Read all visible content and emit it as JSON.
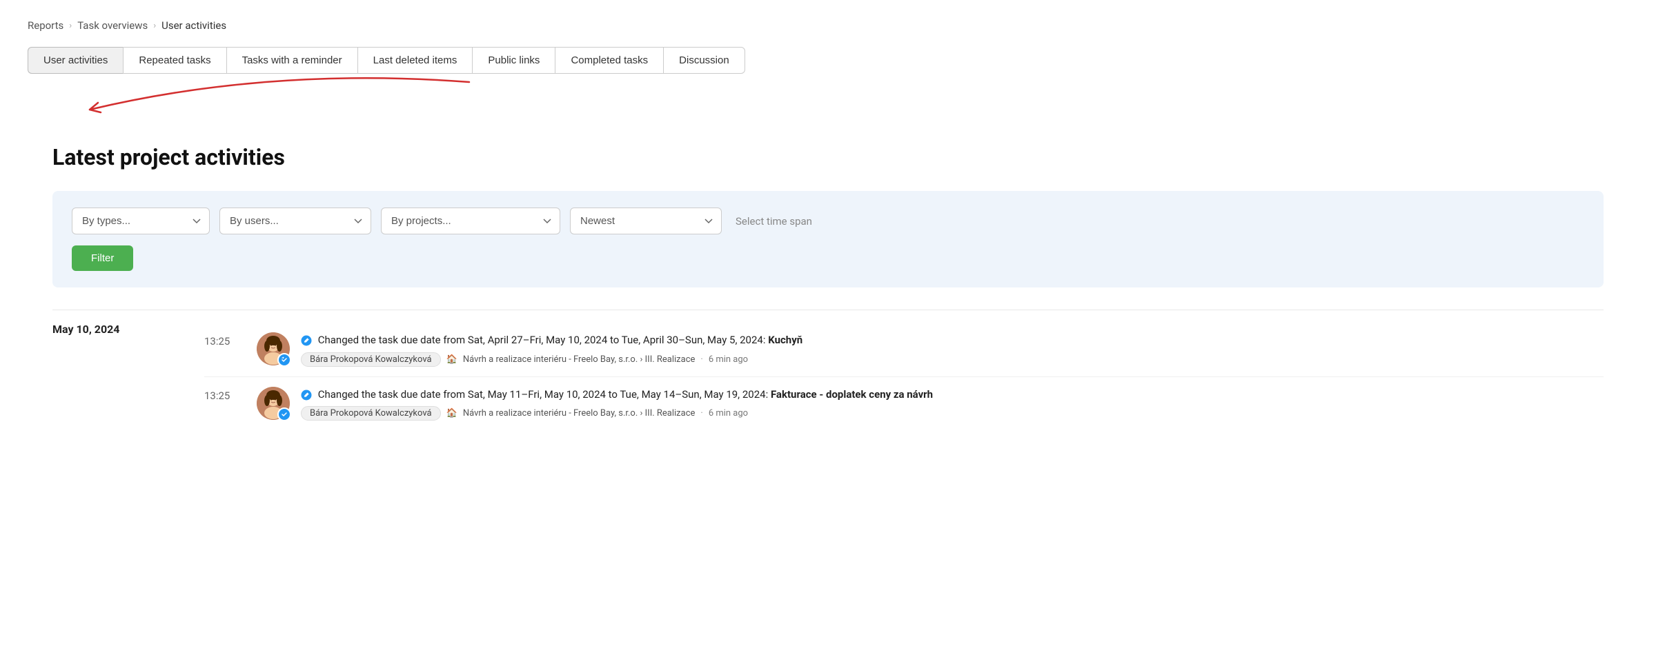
{
  "breadcrumb": {
    "items": [
      {
        "label": "Reports",
        "active": false
      },
      {
        "label": "Task overviews",
        "active": false
      },
      {
        "label": "User activities",
        "active": true
      }
    ]
  },
  "tabs": [
    {
      "id": "user-activities",
      "label": "User activities",
      "active": true
    },
    {
      "id": "repeated-tasks",
      "label": "Repeated tasks",
      "active": false
    },
    {
      "id": "tasks-with-reminder",
      "label": "Tasks with a reminder",
      "active": false
    },
    {
      "id": "last-deleted-items",
      "label": "Last deleted items",
      "active": false
    },
    {
      "id": "public-links",
      "label": "Public links",
      "active": false
    },
    {
      "id": "completed-tasks",
      "label": "Completed tasks",
      "active": false
    },
    {
      "id": "discussion",
      "label": "Discussion",
      "active": false
    }
  ],
  "page_title": "Latest project activities",
  "filters": {
    "by_types": {
      "label": "By types...",
      "value": ""
    },
    "by_users": {
      "label": "By users...",
      "value": ""
    },
    "by_projects": {
      "label": "By projects...",
      "value": ""
    },
    "sort": {
      "label": "Newest",
      "value": "newest"
    },
    "time_span": {
      "label": "Select time span"
    },
    "filter_button": "Filter"
  },
  "activity_groups": [
    {
      "date": "May 10, 2024",
      "items": [
        {
          "time": "13:25",
          "user_name": "Bára Prokopová Kowalczyková",
          "action_prefix": "Changed the task due date from Sat, April 27–Fri, May 10, 2024 to Tue, April 30–Sun, May 5, 2024:",
          "task_name": "Kuchyň",
          "project_icon": "🏠",
          "project": "Návrh a realizace interiéru - Freelo Bay, s.r.o. › III. Realizace",
          "time_ago": "6 min ago"
        },
        {
          "time": "13:25",
          "user_name": "Bára Prokopová Kowalczyková",
          "action_prefix": "Changed the task due date from Sat, May 11–Fri, May 10, 2024 to Tue, May 14–Sun, May 19, 2024:",
          "task_name": "Fakturace - doplatek ceny za návrh",
          "task_name_multiline": true,
          "project_icon": "🏠",
          "project": "Návrh a realizace interiéru - Freelo Bay, s.r.o. › III. Realizace",
          "time_ago": "6 min ago"
        }
      ]
    }
  ]
}
